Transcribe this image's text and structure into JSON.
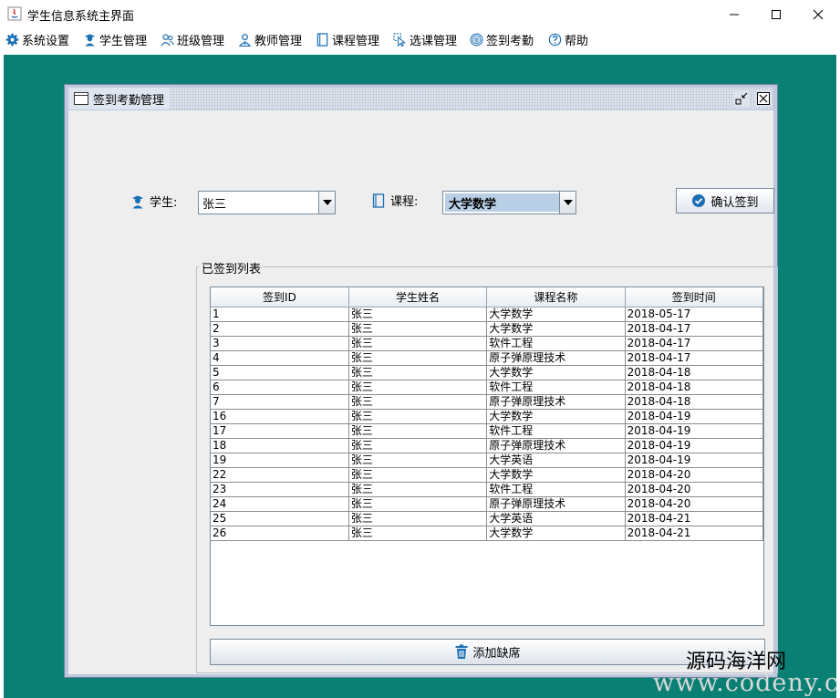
{
  "window": {
    "title": "学生信息系统主界面"
  },
  "menu": {
    "items": [
      {
        "label": "系统设置",
        "icon": "gear-icon"
      },
      {
        "label": "学生管理",
        "icon": "student-icon"
      },
      {
        "label": "班级管理",
        "icon": "class-icon"
      },
      {
        "label": "教师管理",
        "icon": "teacher-icon"
      },
      {
        "label": "课程管理",
        "icon": "course-icon"
      },
      {
        "label": "选课管理",
        "icon": "cursor-icon"
      },
      {
        "label": "签到考勤",
        "icon": "attendance-icon"
      },
      {
        "label": "帮助",
        "icon": "help-icon"
      }
    ]
  },
  "frame": {
    "title": "签到考勤管理"
  },
  "form": {
    "student_label": "学生:",
    "student_value": "张三",
    "course_label": "课程:",
    "course_value": "大学数学",
    "confirm_label": "确认签到"
  },
  "group": {
    "title": "已签到列表"
  },
  "table": {
    "columns": [
      "签到ID",
      "学生姓名",
      "课程名称",
      "签到时间"
    ],
    "rows": [
      [
        "1",
        "张三",
        "大学数学",
        "2018-05-17"
      ],
      [
        "2",
        "张三",
        "大学数学",
        "2018-04-17"
      ],
      [
        "3",
        "张三",
        "软件工程",
        "2018-04-17"
      ],
      [
        "4",
        "张三",
        "原子弹原理技术",
        "2018-04-17"
      ],
      [
        "5",
        "张三",
        "大学数学",
        "2018-04-18"
      ],
      [
        "6",
        "张三",
        "软件工程",
        "2018-04-18"
      ],
      [
        "7",
        "张三",
        "原子弹原理技术",
        "2018-04-18"
      ],
      [
        "16",
        "张三",
        "大学数学",
        "2018-04-19"
      ],
      [
        "17",
        "张三",
        "软件工程",
        "2018-04-19"
      ],
      [
        "18",
        "张三",
        "原子弹原理技术",
        "2018-04-19"
      ],
      [
        "19",
        "张三",
        "大学英语",
        "2018-04-19"
      ],
      [
        "22",
        "张三",
        "大学数学",
        "2018-04-20"
      ],
      [
        "23",
        "张三",
        "软件工程",
        "2018-04-20"
      ],
      [
        "24",
        "张三",
        "原子弹原理技术",
        "2018-04-20"
      ],
      [
        "25",
        "张三",
        "大学英语",
        "2018-04-21"
      ],
      [
        "26",
        "张三",
        "大学数学",
        "2018-04-21"
      ]
    ]
  },
  "actions": {
    "add_absence_label": "添加缺席"
  },
  "watermark": {
    "text": "源码海洋网",
    "url": "www.codeny.com"
  },
  "colors": {
    "desktop": "#098073",
    "accent_blue": "#1a6fb5"
  }
}
